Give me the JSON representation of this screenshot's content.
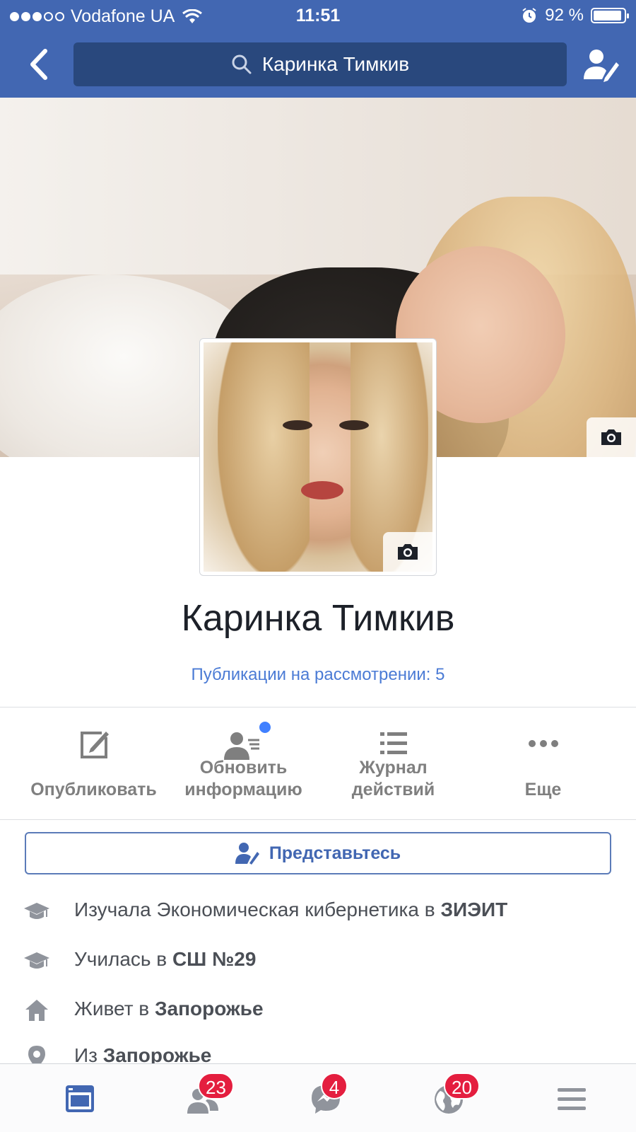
{
  "status_bar": {
    "signal_dots_filled": 3,
    "signal_dots_total": 5,
    "carrier": "Vodafone UA",
    "time": "11:51",
    "battery": "92 %",
    "battery_fraction": 0.92
  },
  "nav": {
    "search_text": "Каринка Тимкив"
  },
  "profile": {
    "name": "Каринка Тимкив",
    "pending_posts": "Публикации на рассмотрении: 5"
  },
  "actions": {
    "publish": "Опубликовать",
    "update_info_line1": "Обновить",
    "update_info_line2": "информацию",
    "activity_log_line1": "Журнал",
    "activity_log_line2": "действий",
    "more": "Еще"
  },
  "introduce": {
    "label": "Представьтесь"
  },
  "info": {
    "studied": {
      "prefix": "Изучала Экономическая кибернетика в ",
      "place": "ЗИЭИТ"
    },
    "school": {
      "prefix": "Училась в ",
      "place": "СШ №29"
    },
    "lives": {
      "prefix": "Живет в ",
      "place": "Запорожье"
    },
    "from": {
      "prefix": "Из ",
      "place": "Запорожье"
    }
  },
  "tabs": {
    "friends_count": "23",
    "messages_count": "4",
    "notifications_count": "20"
  },
  "colors": {
    "brand": "#4267b2",
    "search_bg": "#29487d",
    "link": "#4b7bd5",
    "badge": "#e41e3f",
    "active_tab": "#4267b2"
  },
  "icons": {
    "nav": [
      "back-arrow-icon",
      "search-icon",
      "profile-edit-icon"
    ],
    "tabs": [
      "news-feed-icon",
      "friends-icon",
      "messenger-icon",
      "globe-icon",
      "menu-icon"
    ]
  }
}
